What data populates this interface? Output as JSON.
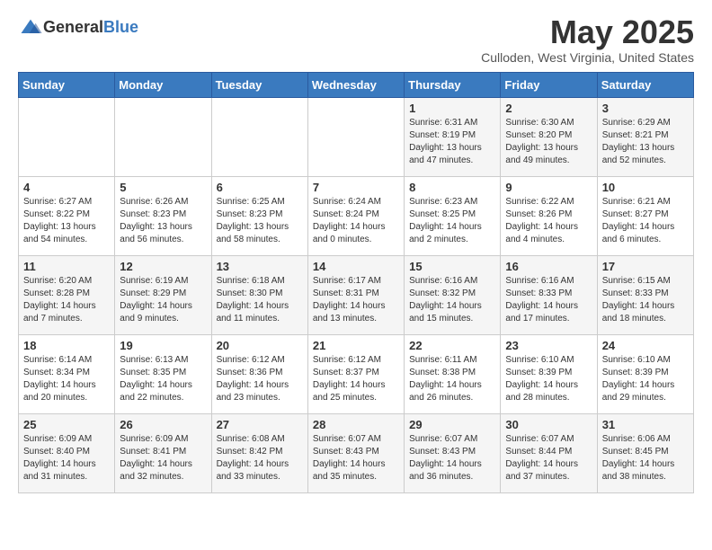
{
  "header": {
    "logo_general": "General",
    "logo_blue": "Blue",
    "title": "May 2025",
    "subtitle": "Culloden, West Virginia, United States"
  },
  "weekdays": [
    "Sunday",
    "Monday",
    "Tuesday",
    "Wednesday",
    "Thursday",
    "Friday",
    "Saturday"
  ],
  "weeks": [
    [
      {
        "day": "",
        "info": ""
      },
      {
        "day": "",
        "info": ""
      },
      {
        "day": "",
        "info": ""
      },
      {
        "day": "",
        "info": ""
      },
      {
        "day": "1",
        "info": "Sunrise: 6:31 AM\nSunset: 8:19 PM\nDaylight: 13 hours\nand 47 minutes."
      },
      {
        "day": "2",
        "info": "Sunrise: 6:30 AM\nSunset: 8:20 PM\nDaylight: 13 hours\nand 49 minutes."
      },
      {
        "day": "3",
        "info": "Sunrise: 6:29 AM\nSunset: 8:21 PM\nDaylight: 13 hours\nand 52 minutes."
      }
    ],
    [
      {
        "day": "4",
        "info": "Sunrise: 6:27 AM\nSunset: 8:22 PM\nDaylight: 13 hours\nand 54 minutes."
      },
      {
        "day": "5",
        "info": "Sunrise: 6:26 AM\nSunset: 8:23 PM\nDaylight: 13 hours\nand 56 minutes."
      },
      {
        "day": "6",
        "info": "Sunrise: 6:25 AM\nSunset: 8:23 PM\nDaylight: 13 hours\nand 58 minutes."
      },
      {
        "day": "7",
        "info": "Sunrise: 6:24 AM\nSunset: 8:24 PM\nDaylight: 14 hours\nand 0 minutes."
      },
      {
        "day": "8",
        "info": "Sunrise: 6:23 AM\nSunset: 8:25 PM\nDaylight: 14 hours\nand 2 minutes."
      },
      {
        "day": "9",
        "info": "Sunrise: 6:22 AM\nSunset: 8:26 PM\nDaylight: 14 hours\nand 4 minutes."
      },
      {
        "day": "10",
        "info": "Sunrise: 6:21 AM\nSunset: 8:27 PM\nDaylight: 14 hours\nand 6 minutes."
      }
    ],
    [
      {
        "day": "11",
        "info": "Sunrise: 6:20 AM\nSunset: 8:28 PM\nDaylight: 14 hours\nand 7 minutes."
      },
      {
        "day": "12",
        "info": "Sunrise: 6:19 AM\nSunset: 8:29 PM\nDaylight: 14 hours\nand 9 minutes."
      },
      {
        "day": "13",
        "info": "Sunrise: 6:18 AM\nSunset: 8:30 PM\nDaylight: 14 hours\nand 11 minutes."
      },
      {
        "day": "14",
        "info": "Sunrise: 6:17 AM\nSunset: 8:31 PM\nDaylight: 14 hours\nand 13 minutes."
      },
      {
        "day": "15",
        "info": "Sunrise: 6:16 AM\nSunset: 8:32 PM\nDaylight: 14 hours\nand 15 minutes."
      },
      {
        "day": "16",
        "info": "Sunrise: 6:16 AM\nSunset: 8:33 PM\nDaylight: 14 hours\nand 17 minutes."
      },
      {
        "day": "17",
        "info": "Sunrise: 6:15 AM\nSunset: 8:33 PM\nDaylight: 14 hours\nand 18 minutes."
      }
    ],
    [
      {
        "day": "18",
        "info": "Sunrise: 6:14 AM\nSunset: 8:34 PM\nDaylight: 14 hours\nand 20 minutes."
      },
      {
        "day": "19",
        "info": "Sunrise: 6:13 AM\nSunset: 8:35 PM\nDaylight: 14 hours\nand 22 minutes."
      },
      {
        "day": "20",
        "info": "Sunrise: 6:12 AM\nSunset: 8:36 PM\nDaylight: 14 hours\nand 23 minutes."
      },
      {
        "day": "21",
        "info": "Sunrise: 6:12 AM\nSunset: 8:37 PM\nDaylight: 14 hours\nand 25 minutes."
      },
      {
        "day": "22",
        "info": "Sunrise: 6:11 AM\nSunset: 8:38 PM\nDaylight: 14 hours\nand 26 minutes."
      },
      {
        "day": "23",
        "info": "Sunrise: 6:10 AM\nSunset: 8:39 PM\nDaylight: 14 hours\nand 28 minutes."
      },
      {
        "day": "24",
        "info": "Sunrise: 6:10 AM\nSunset: 8:39 PM\nDaylight: 14 hours\nand 29 minutes."
      }
    ],
    [
      {
        "day": "25",
        "info": "Sunrise: 6:09 AM\nSunset: 8:40 PM\nDaylight: 14 hours\nand 31 minutes."
      },
      {
        "day": "26",
        "info": "Sunrise: 6:09 AM\nSunset: 8:41 PM\nDaylight: 14 hours\nand 32 minutes."
      },
      {
        "day": "27",
        "info": "Sunrise: 6:08 AM\nSunset: 8:42 PM\nDaylight: 14 hours\nand 33 minutes."
      },
      {
        "day": "28",
        "info": "Sunrise: 6:07 AM\nSunset: 8:43 PM\nDaylight: 14 hours\nand 35 minutes."
      },
      {
        "day": "29",
        "info": "Sunrise: 6:07 AM\nSunset: 8:43 PM\nDaylight: 14 hours\nand 36 minutes."
      },
      {
        "day": "30",
        "info": "Sunrise: 6:07 AM\nSunset: 8:44 PM\nDaylight: 14 hours\nand 37 minutes."
      },
      {
        "day": "31",
        "info": "Sunrise: 6:06 AM\nSunset: 8:45 PM\nDaylight: 14 hours\nand 38 minutes."
      }
    ]
  ]
}
